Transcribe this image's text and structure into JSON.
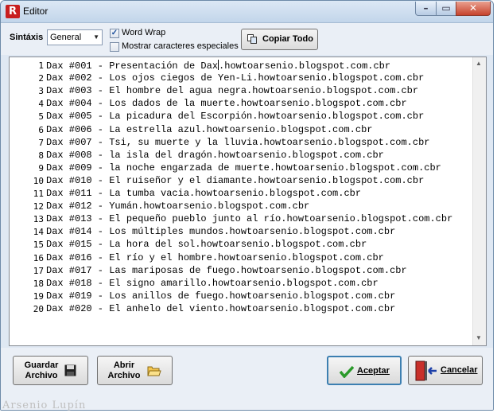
{
  "window": {
    "title": "Editor",
    "app_icon_letter": "R"
  },
  "toolbar": {
    "syntax_label": "Sintáxis",
    "syntax_value": "General",
    "word_wrap_label": "Word Wrap",
    "word_wrap_checked": true,
    "special_chars_label": "Mostrar caracteres especiales",
    "special_chars_checked": false,
    "copy_all_label": "Copiar Todo"
  },
  "editor": {
    "line_numbers": [
      "1",
      "2",
      "3",
      "4",
      "5",
      "6",
      "7",
      "8",
      "9",
      "10",
      "11",
      "12",
      "13",
      "14",
      "15",
      "16",
      "17",
      "18",
      "19",
      "20"
    ],
    "lines": [
      "Dax #001 - Presentación de Dax.howtoarsenio.blogspot.com.cbr",
      "Dax #002 - Los ojos ciegos de Yen-Li.howtoarsenio.blogspot.com.cbr",
      "Dax #003 - El hombre del agua negra.howtoarsenio.blogspot.com.cbr",
      "Dax #004 - Los dados de la muerte.howtoarsenio.blogspot.com.cbr",
      "Dax #005 - La picadura del Escorpión.howtoarsenio.blogspot.com.cbr",
      "Dax #006 - La estrella azul.howtoarsenio.blogspot.com.cbr",
      "Dax #007 - Tsi, su muerte y la lluvia.howtoarsenio.blogspot.com.cbr",
      "Dax #008 - la isla del dragón.howtoarsenio.blogspot.com.cbr",
      "Dax #009 - la noche engarzada de muerte.howtoarsenio.blogspot.com.cbr",
      "Dax #010 - El ruiseñor y el diamante.howtoarsenio.blogspot.com.cbr",
      "Dax #011 - La tumba vacia.howtoarsenio.blogspot.com.cbr",
      "Dax #012 - Yumán.howtoarsenio.blogspot.com.cbr",
      "Dax #013 - El pequeño pueblo junto al río.howtoarsenio.blogspot.com.cbr",
      "Dax #014 - Los múltiples mundos.howtoarsenio.blogspot.com.cbr",
      "Dax #015 - La hora del sol.howtoarsenio.blogspot.com.cbr",
      "Dax #016 - El río y el hombre.howtoarsenio.blogspot.com.cbr",
      "Dax #017 - Las mariposas de fuego.howtoarsenio.blogspot.com.cbr",
      "Dax #018 - El signo amarillo.howtoarsenio.blogspot.com.cbr",
      "Dax #019 - Los anillos de fuego.howtoarsenio.blogspot.com.cbr",
      "Dax #020 - El anhelo del viento.howtoarsenio.blogspot.com.cbr"
    ]
  },
  "footer": {
    "save_label_1": "Guardar",
    "save_label_2": "Archivo",
    "open_label_1": "Abrir",
    "open_label_2": "Archivo",
    "accept_label": "Aceptar",
    "cancel_label": "Cancelar"
  },
  "watermark": "Arsenio Lupín",
  "icons": {
    "app": "app-logo-icon",
    "copy": "copy-icon",
    "save": "floppy-disk-icon",
    "open": "folder-open-icon",
    "accept": "checkmark-icon",
    "cancel": "exit-door-icon"
  },
  "colors": {
    "accept_check": "#2a9a2a",
    "close_button": "#c6432d",
    "app_icon": "#c81e1e"
  }
}
